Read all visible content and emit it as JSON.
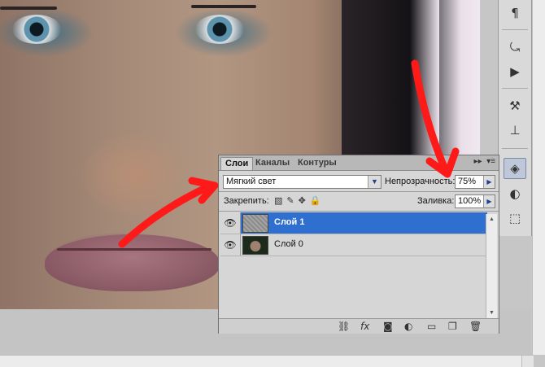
{
  "layers_panel": {
    "tabs": [
      {
        "label": "Слои",
        "active": true
      },
      {
        "label": "Каналы",
        "active": false
      },
      {
        "label": "Контуры",
        "active": false
      }
    ],
    "blend_mode": "Мягкий свет",
    "opacity_label": "Непрозрачность:",
    "opacity_value": "75%",
    "lock_label": "Закрепить:",
    "fill_label": "Заливка:",
    "fill_value": "100%",
    "layers": [
      {
        "name": "Слой 1",
        "selected": true,
        "visible": true
      },
      {
        "name": "Слой 0",
        "selected": false,
        "visible": true
      }
    ],
    "footer_icons": [
      "link-icon",
      "fx-icon",
      "mask-icon",
      "adjustment-icon",
      "folder-icon",
      "new-layer-icon",
      "trash-icon"
    ]
  },
  "dock_icons": [
    "paragraph-icon",
    "history-icon",
    "actions-icon",
    "tool-presets-icon",
    "clone-source-icon",
    "layers-icon",
    "channels-icon",
    "paths-icon"
  ],
  "colors": {
    "selection": "#2f6fd0",
    "annotation_arrow": "#ff1a1a"
  }
}
